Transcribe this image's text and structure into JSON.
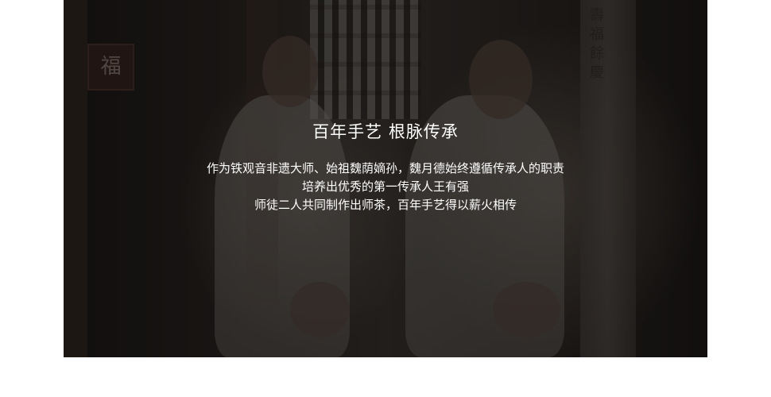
{
  "banner": {
    "title": "百年手艺 根脉传承",
    "lines": [
      "作为铁观音非遗大师、始祖魏荫嫡孙，魏月德始终遵循传承人的职责",
      "培养出优秀的第一传承人王有强",
      "师徒二人共同制作出师茶，百年手艺得以薪火相传"
    ],
    "sign_char": "福",
    "pillar_text": "壽\n福\n餘\n慶"
  }
}
